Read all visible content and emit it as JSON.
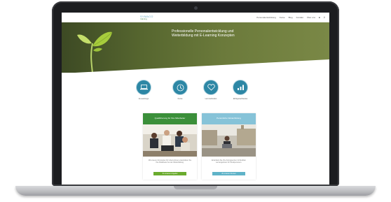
{
  "site": {
    "logo_line1": "SYMACO",
    "logo_line2": "training",
    "menu": [
      "Personalentwicklung",
      "Kurse",
      "Blog",
      "Kontakt",
      "Über uns",
      "",
      ""
    ],
    "hero": {
      "headline": "Professionelle Personalentwicklung und Weiterbildung mit E-Learning Konzepten"
    },
    "features": [
      {
        "label": "E-Learnings",
        "icon": "laptop-icon"
      },
      {
        "label": "Kurse",
        "icon": "clock-icon"
      },
      {
        "label": "Lernmethoden",
        "icon": "heart-icon"
      },
      {
        "label": "Erfolgsnachweise",
        "icon": "chart-icon"
      }
    ],
    "cards": [
      {
        "title": "Qualifizierung für Ihre Mitarbeiter",
        "text": "Mit unseren Konzepten für Unternehmen unterstützen Sie Ihre Mitarbeiter bei der Weiterbildung.",
        "button": "Zu unseren Angebot",
        "color": "#3b8f3a",
        "button_color": "#6aab2e"
      },
      {
        "title": "Persönliche Weiterbildung",
        "text": "Entwickeln Sie Ihre Kompetenzen mit flexiblen Lernangeboten für Privatpersonen.",
        "button": "Zu unseren Kursen",
        "color": "#86c3d8",
        "button_color": "#5fb3c8"
      }
    ]
  },
  "colors": {
    "accent": "#2d87a5",
    "hero_green": "#56662f"
  }
}
